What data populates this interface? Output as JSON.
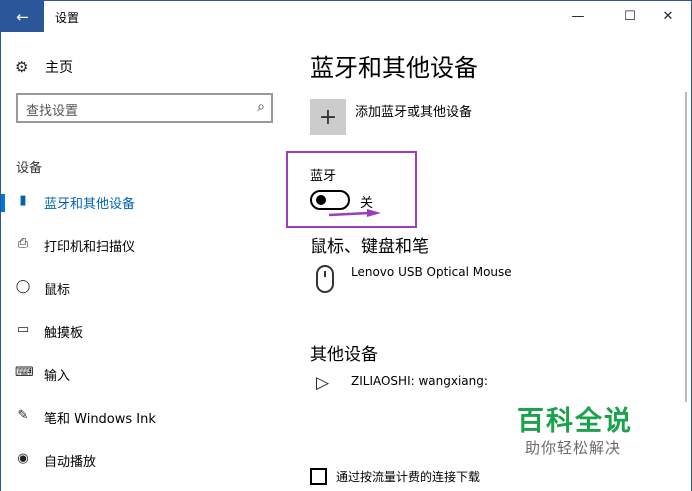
{
  "titlebar": {
    "title": "设置",
    "back_icon": "←",
    "minimize_icon": "—",
    "maximize_icon": "☐",
    "close_icon": "✕"
  },
  "sidebar": {
    "home_label": "主页",
    "home_icon": "⚙",
    "search_placeholder": "查找设置",
    "search_icon": "⌕",
    "section_label": "设备",
    "items": [
      {
        "label": "蓝牙和其他设备",
        "icon": "▮",
        "active": true
      },
      {
        "label": "打印机和扫描仪",
        "icon": "⎙",
        "active": false
      },
      {
        "label": "鼠标",
        "icon": "◯",
        "active": false
      },
      {
        "label": "触摸板",
        "icon": "▭",
        "active": false
      },
      {
        "label": "输入",
        "icon": "⌨",
        "active": false
      },
      {
        "label": "笔和 Windows Ink",
        "icon": "✎",
        "active": false
      },
      {
        "label": "自动播放",
        "icon": "◉",
        "active": false
      }
    ],
    "accent_color": "#0078d7"
  },
  "main": {
    "page_title": "蓝牙和其他设备",
    "add_device_label": "添加蓝牙或其他设备",
    "add_icon": "+",
    "bluetooth": {
      "title": "蓝牙",
      "state_label": "关",
      "enabled": false
    },
    "mouse_section": {
      "title": "鼠标、键盘和笔",
      "device_name": "Lenovo USB Optical Mouse"
    },
    "other_section": {
      "title": "其他设备",
      "device_name": "ZILIAOSHI: wangxiang:",
      "device_icon": "▷"
    },
    "metered_checkbox_label": "通过按流量计费的连接下载",
    "highlight_color": "#9b3dbd"
  },
  "watermark": {
    "main": "百科全说",
    "sub": "助你轻松解决"
  }
}
